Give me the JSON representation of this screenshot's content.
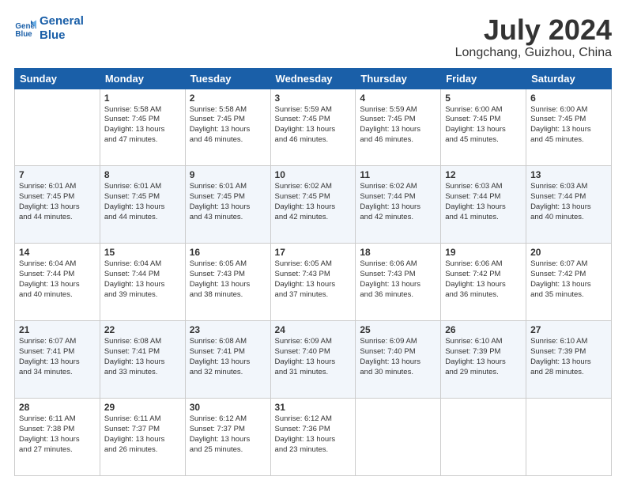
{
  "logo": {
    "line1": "General",
    "line2": "Blue"
  },
  "title": "July 2024",
  "location": "Longchang, Guizhou, China",
  "headers": [
    "Sunday",
    "Monday",
    "Tuesday",
    "Wednesday",
    "Thursday",
    "Friday",
    "Saturday"
  ],
  "weeks": [
    [
      {
        "day": "",
        "info": ""
      },
      {
        "day": "1",
        "info": "Sunrise: 5:58 AM\nSunset: 7:45 PM\nDaylight: 13 hours\nand 47 minutes."
      },
      {
        "day": "2",
        "info": "Sunrise: 5:58 AM\nSunset: 7:45 PM\nDaylight: 13 hours\nand 46 minutes."
      },
      {
        "day": "3",
        "info": "Sunrise: 5:59 AM\nSunset: 7:45 PM\nDaylight: 13 hours\nand 46 minutes."
      },
      {
        "day": "4",
        "info": "Sunrise: 5:59 AM\nSunset: 7:45 PM\nDaylight: 13 hours\nand 46 minutes."
      },
      {
        "day": "5",
        "info": "Sunrise: 6:00 AM\nSunset: 7:45 PM\nDaylight: 13 hours\nand 45 minutes."
      },
      {
        "day": "6",
        "info": "Sunrise: 6:00 AM\nSunset: 7:45 PM\nDaylight: 13 hours\nand 45 minutes."
      }
    ],
    [
      {
        "day": "7",
        "info": "Sunrise: 6:01 AM\nSunset: 7:45 PM\nDaylight: 13 hours\nand 44 minutes."
      },
      {
        "day": "8",
        "info": "Sunrise: 6:01 AM\nSunset: 7:45 PM\nDaylight: 13 hours\nand 44 minutes."
      },
      {
        "day": "9",
        "info": "Sunrise: 6:01 AM\nSunset: 7:45 PM\nDaylight: 13 hours\nand 43 minutes."
      },
      {
        "day": "10",
        "info": "Sunrise: 6:02 AM\nSunset: 7:45 PM\nDaylight: 13 hours\nand 42 minutes."
      },
      {
        "day": "11",
        "info": "Sunrise: 6:02 AM\nSunset: 7:44 PM\nDaylight: 13 hours\nand 42 minutes."
      },
      {
        "day": "12",
        "info": "Sunrise: 6:03 AM\nSunset: 7:44 PM\nDaylight: 13 hours\nand 41 minutes."
      },
      {
        "day": "13",
        "info": "Sunrise: 6:03 AM\nSunset: 7:44 PM\nDaylight: 13 hours\nand 40 minutes."
      }
    ],
    [
      {
        "day": "14",
        "info": "Sunrise: 6:04 AM\nSunset: 7:44 PM\nDaylight: 13 hours\nand 40 minutes."
      },
      {
        "day": "15",
        "info": "Sunrise: 6:04 AM\nSunset: 7:44 PM\nDaylight: 13 hours\nand 39 minutes."
      },
      {
        "day": "16",
        "info": "Sunrise: 6:05 AM\nSunset: 7:43 PM\nDaylight: 13 hours\nand 38 minutes."
      },
      {
        "day": "17",
        "info": "Sunrise: 6:05 AM\nSunset: 7:43 PM\nDaylight: 13 hours\nand 37 minutes."
      },
      {
        "day": "18",
        "info": "Sunrise: 6:06 AM\nSunset: 7:43 PM\nDaylight: 13 hours\nand 36 minutes."
      },
      {
        "day": "19",
        "info": "Sunrise: 6:06 AM\nSunset: 7:42 PM\nDaylight: 13 hours\nand 36 minutes."
      },
      {
        "day": "20",
        "info": "Sunrise: 6:07 AM\nSunset: 7:42 PM\nDaylight: 13 hours\nand 35 minutes."
      }
    ],
    [
      {
        "day": "21",
        "info": "Sunrise: 6:07 AM\nSunset: 7:41 PM\nDaylight: 13 hours\nand 34 minutes."
      },
      {
        "day": "22",
        "info": "Sunrise: 6:08 AM\nSunset: 7:41 PM\nDaylight: 13 hours\nand 33 minutes."
      },
      {
        "day": "23",
        "info": "Sunrise: 6:08 AM\nSunset: 7:41 PM\nDaylight: 13 hours\nand 32 minutes."
      },
      {
        "day": "24",
        "info": "Sunrise: 6:09 AM\nSunset: 7:40 PM\nDaylight: 13 hours\nand 31 minutes."
      },
      {
        "day": "25",
        "info": "Sunrise: 6:09 AM\nSunset: 7:40 PM\nDaylight: 13 hours\nand 30 minutes."
      },
      {
        "day": "26",
        "info": "Sunrise: 6:10 AM\nSunset: 7:39 PM\nDaylight: 13 hours\nand 29 minutes."
      },
      {
        "day": "27",
        "info": "Sunrise: 6:10 AM\nSunset: 7:39 PM\nDaylight: 13 hours\nand 28 minutes."
      }
    ],
    [
      {
        "day": "28",
        "info": "Sunrise: 6:11 AM\nSunset: 7:38 PM\nDaylight: 13 hours\nand 27 minutes."
      },
      {
        "day": "29",
        "info": "Sunrise: 6:11 AM\nSunset: 7:37 PM\nDaylight: 13 hours\nand 26 minutes."
      },
      {
        "day": "30",
        "info": "Sunrise: 6:12 AM\nSunset: 7:37 PM\nDaylight: 13 hours\nand 25 minutes."
      },
      {
        "day": "31",
        "info": "Sunrise: 6:12 AM\nSunset: 7:36 PM\nDaylight: 13 hours\nand 23 minutes."
      },
      {
        "day": "",
        "info": ""
      },
      {
        "day": "",
        "info": ""
      },
      {
        "day": "",
        "info": ""
      }
    ]
  ]
}
